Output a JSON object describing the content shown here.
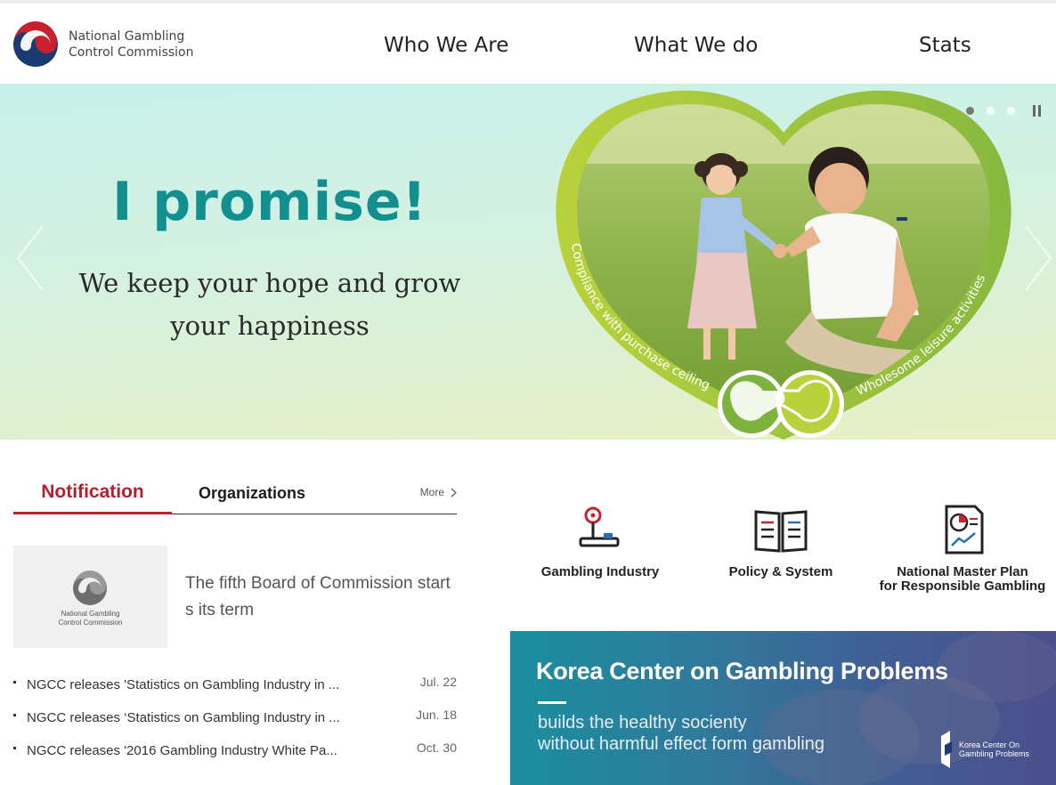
{
  "header": {
    "logo_line1": "National Gambling",
    "logo_line2": "Control Commission",
    "nav": [
      "Who We Are",
      "What We do",
      "Stats"
    ]
  },
  "hero": {
    "title": "I promise!",
    "subtitle_line1": "We keep your hope and grow",
    "subtitle_line2": "your happiness",
    "heart_left_text": "Compliance with purchase ceiling",
    "heart_right_text": "Wholesome leisure activities",
    "slide_count": 3,
    "active_slide": 1
  },
  "notice": {
    "tabs": [
      "Notification",
      "Organizations"
    ],
    "active_tab": "Notification",
    "more_label": "More",
    "featured": {
      "thumb_caption_line1": "National Gambling",
      "thumb_caption_line2": "Control Commission",
      "title": "The fifth Board of Commission starts its term"
    },
    "items": [
      {
        "title": "NGCC releases 'Statistics on Gambling Industry in ...",
        "date": "Jul. 22"
      },
      {
        "title": "NGCC releases ‘Statistics on Gambling Industry in ...",
        "date": "Jun. 18"
      },
      {
        "title": "NGCC releases '2016 Gambling Industry White Pa...",
        "date": "Oct. 30"
      }
    ]
  },
  "quick_links": [
    {
      "label": "Gambling Industry",
      "icon": "joystick-icon"
    },
    {
      "label": "Policy & System",
      "icon": "open-book-icon"
    },
    {
      "label_line1": "National Master Plan",
      "label_line2": "for Responsible Gambling",
      "icon": "chart-document-icon"
    }
  ],
  "banner": {
    "title": "Korea Center on Gambling Problems",
    "sub_line1": "builds the healthy socienty",
    "sub_line2": "without harmful effect form gambling",
    "brand_line1": "Korea Center On",
    "brand_line2": "Gambling Problems"
  },
  "colors": {
    "accent_red": "#b3202c",
    "hero_title": "#138f8f",
    "heart_green": "#a6c93c"
  }
}
